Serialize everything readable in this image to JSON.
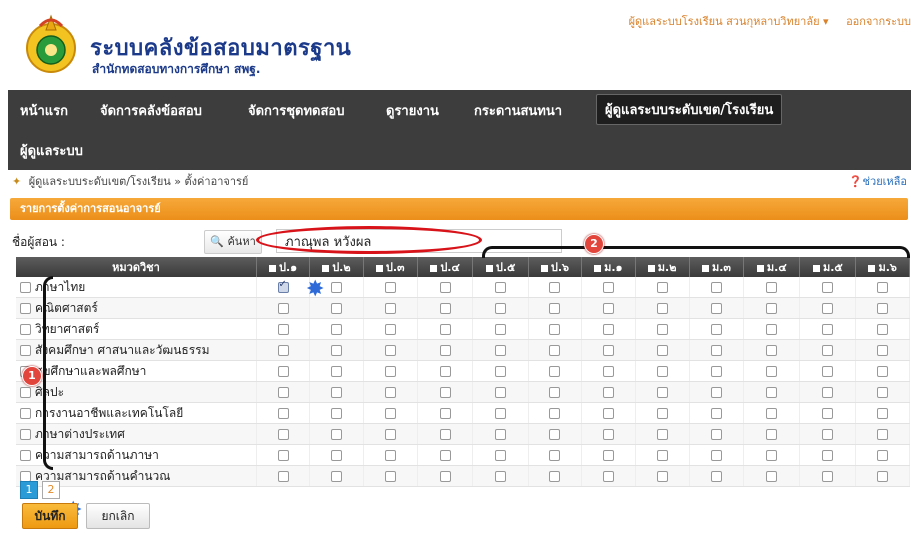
{
  "header": {
    "title": "ระบบคลังข้อสอบมาตรฐาน",
    "subtitle": "สำนักทดสอบทางการศึกษา สพฐ.",
    "user_menu": "ผู้ดูแลระบบโรงเรียน สวนกุหลาบวิทยาลัย ▾",
    "logout": "ออกจากระบบ"
  },
  "nav": {
    "items": [
      {
        "label": "หน้าแรก"
      },
      {
        "label": "จัดการคลังข้อสอบ"
      },
      {
        "label": "จัดการชุดทดสอบ"
      },
      {
        "label": "ดูรายงาน"
      },
      {
        "label": "กระดานสนทนา"
      },
      {
        "label": "ผู้ดูแลระบบระดับเขต/โรงเรียน"
      },
      {
        "label": "ผู้ดูแลระบบ"
      }
    ],
    "active_index": 5
  },
  "breadcrumb": "ผู้ดูแลระบบระดับเขต/โรงเรียน » ตั้งค่าอาจารย์",
  "help": "ช่วยเหลือ",
  "panel_title": "รายการตั้งค่าการสอนอาจารย์",
  "teacher": {
    "label": "ชื่อผู้สอน :",
    "search_label": "ค้นหา",
    "value": "ภาณุพล หวังผล"
  },
  "table": {
    "subject_header": "หมวดวิชา",
    "grades": [
      "ป.๑",
      "ป.๒",
      "ป.๓",
      "ป.๔",
      "ป.๕",
      "ป.๖",
      "ม.๑",
      "ม.๒",
      "ม.๓",
      "ม.๔",
      "ม.๕",
      "ม.๖"
    ],
    "subjects": [
      "ภาษาไทย",
      "คณิตศาสตร์",
      "วิทยาศาสตร์",
      "สังคมศึกษา ศาสนาและวัฒนธรรม",
      "สุขศึกษาและพลศึกษา",
      "ศิลปะ",
      "การงานอาชีพและเทคโนโลยี",
      "ภาษาต่างประเทศ",
      "ความสามารถด้านภาษา",
      "ความสามารถด้านคำนวณ"
    ],
    "checked": [
      [
        0,
        0
      ]
    ]
  },
  "annotations": {
    "badge1": "1",
    "badge2": "2"
  },
  "pagination": {
    "pages": [
      "1",
      "2"
    ],
    "active": "1"
  },
  "buttons": {
    "save": "บันทึก",
    "cancel": "ยกเลิก"
  },
  "colors": {
    "accent": "#ec8e1a",
    "nav_bg": "#3d3d3d",
    "title": "#1c3a8a",
    "annotation_red": "#d8141a"
  }
}
